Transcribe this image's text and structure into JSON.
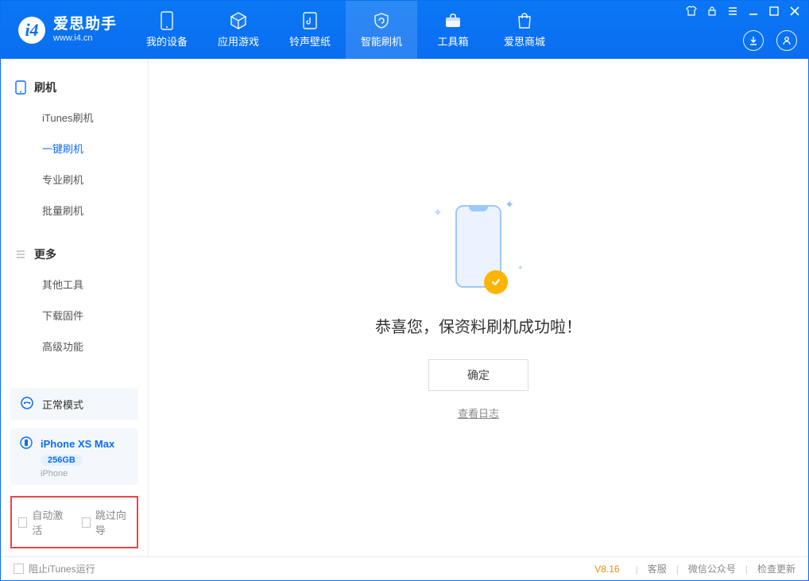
{
  "brand": {
    "title": "爱思助手",
    "url": "www.i4.cn",
    "logo_glyph": "i4"
  },
  "nav": {
    "items": [
      {
        "label": "我的设备"
      },
      {
        "label": "应用游戏"
      },
      {
        "label": "铃声壁纸"
      },
      {
        "label": "智能刷机",
        "active": true
      },
      {
        "label": "工具箱"
      },
      {
        "label": "爱思商城"
      }
    ]
  },
  "sidebar": {
    "group_flash": {
      "title": "刷机",
      "items": [
        {
          "label": "iTunes刷机"
        },
        {
          "label": "一键刷机",
          "active": true
        },
        {
          "label": "专业刷机"
        },
        {
          "label": "批量刷机"
        }
      ]
    },
    "group_more": {
      "title": "更多",
      "items": [
        {
          "label": "其他工具"
        },
        {
          "label": "下载固件"
        },
        {
          "label": "高级功能"
        }
      ]
    },
    "mode": {
      "label": "正常模式"
    },
    "device": {
      "name": "iPhone XS Max",
      "storage": "256GB",
      "type": "iPhone"
    },
    "checkboxes": {
      "auto_activate": "自动激活",
      "skip_guide": "跳过向导"
    }
  },
  "main": {
    "success_title": "恭喜您，保资料刷机成功啦！",
    "ok_btn": "确定",
    "log_link": "查看日志"
  },
  "footer": {
    "block_itunes": "阻止iTunes运行",
    "version": "V8.16",
    "links": {
      "service": "客服",
      "wechat": "微信公众号",
      "check_update": "检查更新"
    }
  }
}
